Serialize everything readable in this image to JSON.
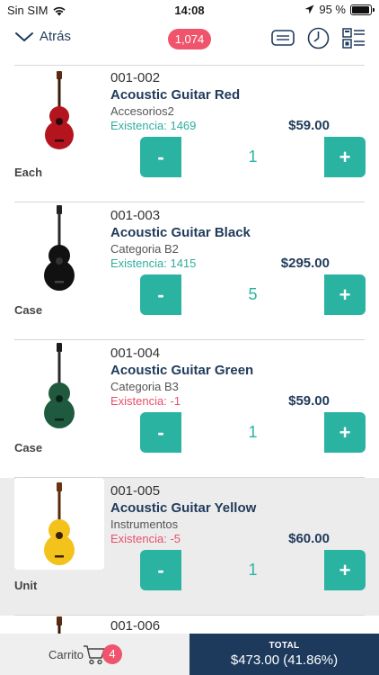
{
  "status_bar": {
    "carrier": "Sin SIM",
    "time": "14:08",
    "battery_text": "95 %",
    "battery_level": 0.95
  },
  "nav": {
    "back_label": "Atrás",
    "item_count": "1,074"
  },
  "products": [
    {
      "code": "001-002",
      "name": "Acoustic Guitar Red",
      "category": "Accesorios2",
      "stock": "Existencia: 1469",
      "price": "$59.00",
      "quantity": "1",
      "unit": "Each",
      "minus": "-",
      "plus": "+",
      "guitar_color": "#b3141e"
    },
    {
      "code": "001-003",
      "name": "Acoustic Guitar Black",
      "category": "Categoria B2",
      "stock": "Existencia: 1415",
      "price": "$295.00",
      "quantity": "5",
      "unit": "Case",
      "minus": "-",
      "plus": "+",
      "guitar_color": "#111111"
    },
    {
      "code": "001-004",
      "name": "Acoustic Guitar Green",
      "category": "Categoria B3",
      "stock": "Existencia: -1",
      "price": "$59.00",
      "quantity": "1",
      "unit": "Case",
      "minus": "-",
      "plus": "+",
      "guitar_color": "#1f5a3f"
    },
    {
      "code": "001-005",
      "name": "Acoustic Guitar Yellow",
      "category": "Instrumentos",
      "stock": "Existencia: -5",
      "price": "$60.00",
      "quantity": "1",
      "unit": "Unit",
      "minus": "-",
      "plus": "+",
      "guitar_color": "#f3c21b"
    }
  ],
  "partial_product": {
    "code": "001-006"
  },
  "footer": {
    "cart_label": "Carrito",
    "cart_count": "4",
    "total_label": "TOTAL",
    "total_value": "$473.00 (41.86%)"
  },
  "colors": {
    "accent": "#2bb3a2",
    "badge": "#f0546d",
    "navy": "#1d3a5c",
    "stock_ok": "#2fae9f",
    "stock_negative": "#ea4f6c"
  },
  "icons": [
    "wifi-icon",
    "location-arrow-icon",
    "battery-icon",
    "chevron-down-icon",
    "barcode-icon",
    "clock-icon",
    "list-view-icon",
    "cart-icon"
  ]
}
